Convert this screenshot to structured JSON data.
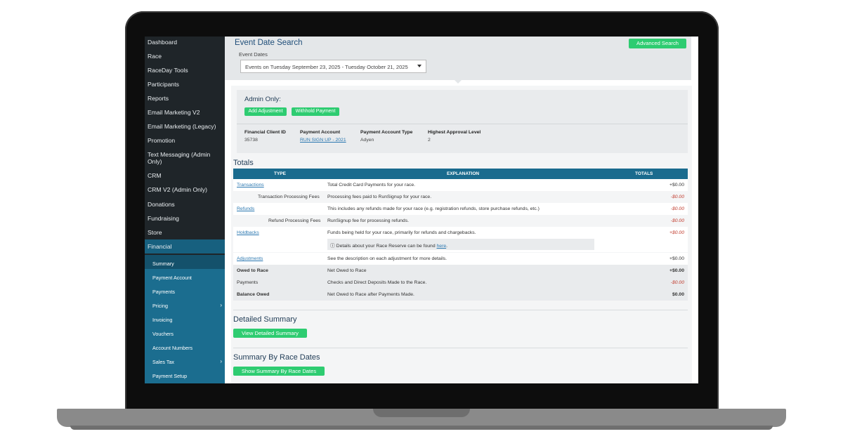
{
  "sidebar": {
    "items": [
      {
        "label": "Dashboard"
      },
      {
        "label": "Race"
      },
      {
        "label": "RaceDay Tools"
      },
      {
        "label": "Participants"
      },
      {
        "label": "Reports"
      },
      {
        "label": "Email Marketing V2"
      },
      {
        "label": "Email Marketing (Legacy)"
      },
      {
        "label": "Promotion"
      },
      {
        "label": "Text Messaging (Admin Only)"
      },
      {
        "label": "CRM"
      },
      {
        "label": "CRM V2 (Admin Only)"
      },
      {
        "label": "Donations"
      },
      {
        "label": "Fundraising"
      },
      {
        "label": "Store"
      },
      {
        "label": "Financial"
      }
    ],
    "subitems": [
      {
        "label": "Summary"
      },
      {
        "label": "Payment Account"
      },
      {
        "label": "Payments"
      },
      {
        "label": "Pricing"
      },
      {
        "label": "Invoicing"
      },
      {
        "label": "Vouchers"
      },
      {
        "label": "Account Numbers"
      },
      {
        "label": "Sales Tax"
      },
      {
        "label": "Payment Setup"
      }
    ]
  },
  "search": {
    "title": "Event Date Search",
    "event_dates_label": "Event Dates",
    "selected": "Events on Tuesday September 23, 2025 - Tuesday October 21, 2025",
    "advanced_label": "Advanced Search"
  },
  "admin": {
    "title": "Admin Only:",
    "add_adjustment": "Add Adjustment",
    "withhold_payment": "Withhold Payment",
    "fields": [
      {
        "head": "Financial Client ID",
        "value": "35738"
      },
      {
        "head": "Payment Account",
        "value": "RUN SIGN UP - 2021"
      },
      {
        "head": "Payment Account Type",
        "value": "Adyen"
      },
      {
        "head": "Highest Approval Level",
        "value": "2"
      }
    ]
  },
  "totals": {
    "title": "Totals",
    "headers": {
      "type": "TYPE",
      "explanation": "EXPLANATION",
      "totals": "TOTALS"
    },
    "rows": [
      {
        "type": "Transactions",
        "explanation": "Total Credit Card Payments for your race.",
        "total": "+$0.00"
      },
      {
        "type": "Transaction Processing Fees",
        "explanation": "Processing fees paid to RunSignup for your race.",
        "total": "-$0.00"
      },
      {
        "type": "Refunds",
        "explanation": "This includes any refunds made for your race (e.g. registration refunds, store purchase refunds, etc.)",
        "total": "-$0.00"
      },
      {
        "type": "Refund Processing Fees",
        "explanation": "RunSignup fee for processing refunds.",
        "total": "-$0.00"
      },
      {
        "type": "Holdbacks",
        "explanation": "Funds being held for your race, primarily for refunds and chargebacks.",
        "total": "+$0.00"
      },
      {
        "type": "Adjustments",
        "explanation": "See the description on each adjustment for more details.",
        "total": "+$0.00"
      },
      {
        "type": "Owed to Race",
        "explanation": "Net Owed to Race",
        "total": "+$0.00"
      },
      {
        "type": "Payments",
        "explanation": "Checks and Direct Deposits Made to the Race.",
        "total": "-$0.00"
      },
      {
        "type": "Balance Owed",
        "explanation": "Net Owed to Race after Payments Made.",
        "total": "$0.00"
      }
    ],
    "reserve_note": "ⓘ Details about your Race Reserve can be found",
    "reserve_link": "here"
  },
  "detailed": {
    "title": "Detailed Summary",
    "button": "View Detailed Summary"
  },
  "by_dates": {
    "title": "Summary By Race Dates",
    "button": "Show Summary By Race Dates"
  },
  "colors": {
    "accent": "#2ecc71",
    "header": "#1a6b8e",
    "sidebar": "#1f2529",
    "negative": "#c0392b"
  },
  "icons": {
    "dropdown": "chevron-down-icon",
    "submenu": "chevron-right-icon",
    "info": "info-icon"
  }
}
